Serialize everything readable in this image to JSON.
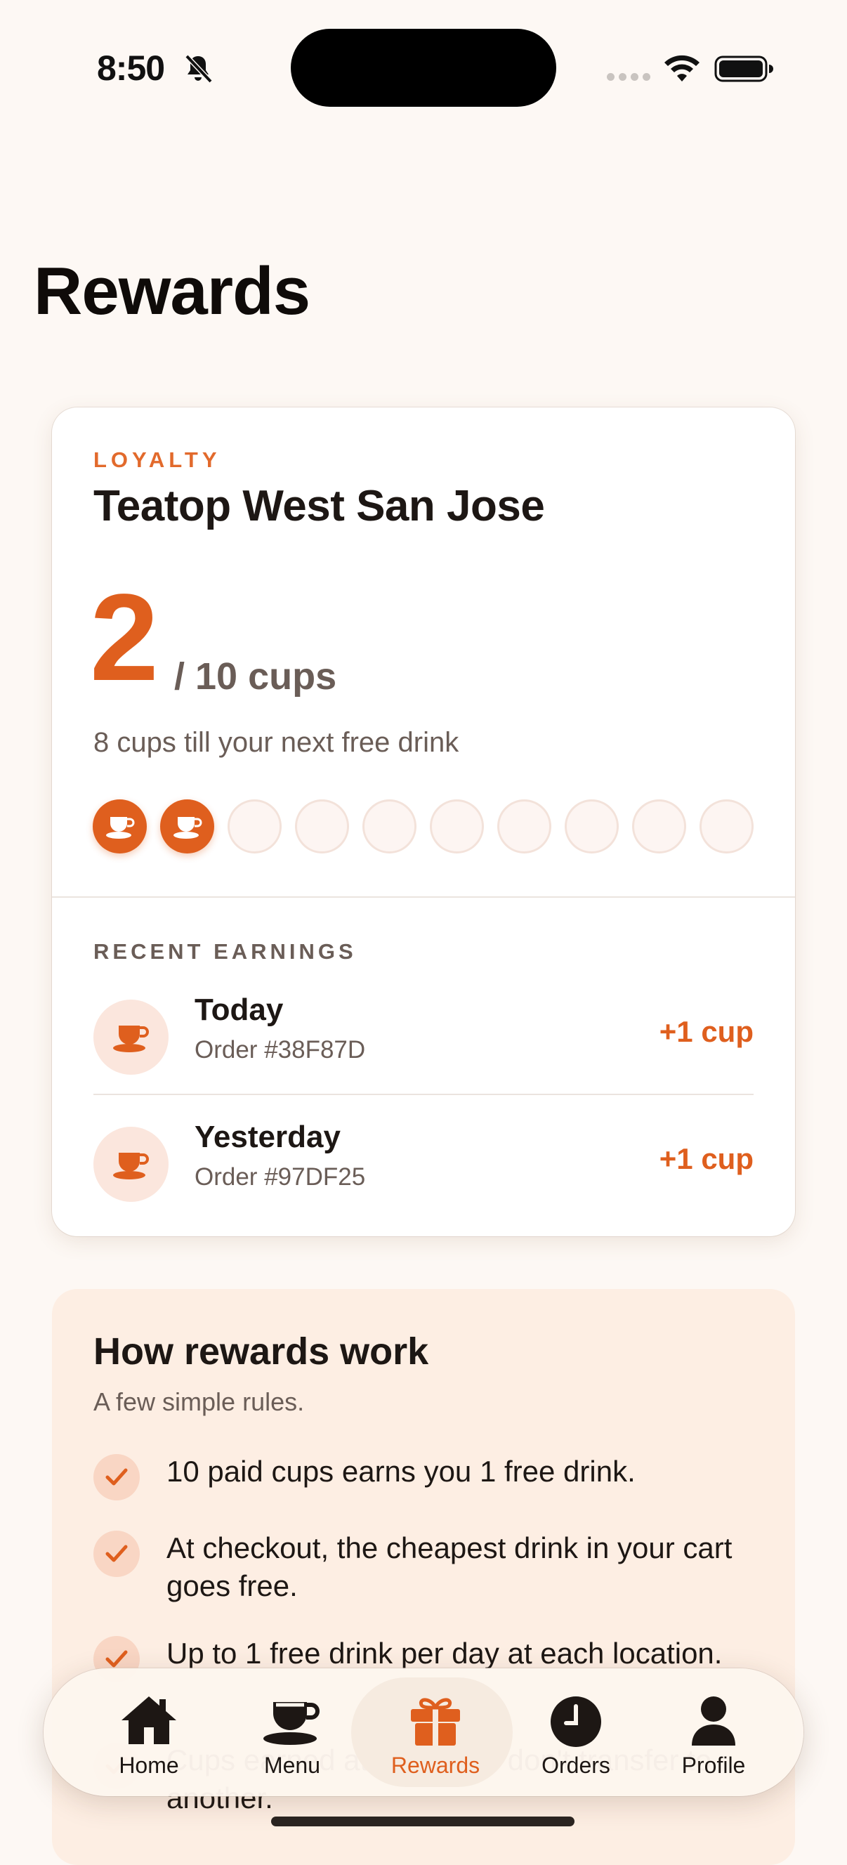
{
  "status_bar": {
    "time": "8:50"
  },
  "page": {
    "title": "Rewards"
  },
  "loyalty": {
    "eyebrow": "LOYALTY",
    "store_name": "Teatop West San Jose",
    "cups_count": "2",
    "cups_total": "/ 10 cups",
    "cups_left_text": "8 cups till your next free drink",
    "stamps_filled": 2,
    "stamps_total": 10
  },
  "recent": {
    "label": "RECENT EARNINGS",
    "items": [
      {
        "when": "Today",
        "order": "Order #38F87D",
        "points": "+1 cup"
      },
      {
        "when": "Yesterday",
        "order": "Order #97DF25",
        "points": "+1 cup"
      }
    ]
  },
  "how": {
    "title": "How rewards work",
    "subtitle": "A few simple rules.",
    "rules": [
      "10 paid cups earns you 1 free drink.",
      "At checkout, the cheapest drink in your cart goes free.",
      "Up to 1 free drink per day at each location.",
      "Cups earned at one store don't transfer to another."
    ]
  },
  "tabs": [
    {
      "label": "Home",
      "icon": "home-icon"
    },
    {
      "label": "Menu",
      "icon": "cup-icon"
    },
    {
      "label": "Rewards",
      "icon": "gift-icon",
      "active": true
    },
    {
      "label": "Orders",
      "icon": "clock-icon"
    },
    {
      "label": "Profile",
      "icon": "person-icon"
    }
  ],
  "colors": {
    "accent": "#df5f1e",
    "background": "#fdf8f4",
    "card": "#ffffff",
    "muted": "#6a5d57"
  }
}
